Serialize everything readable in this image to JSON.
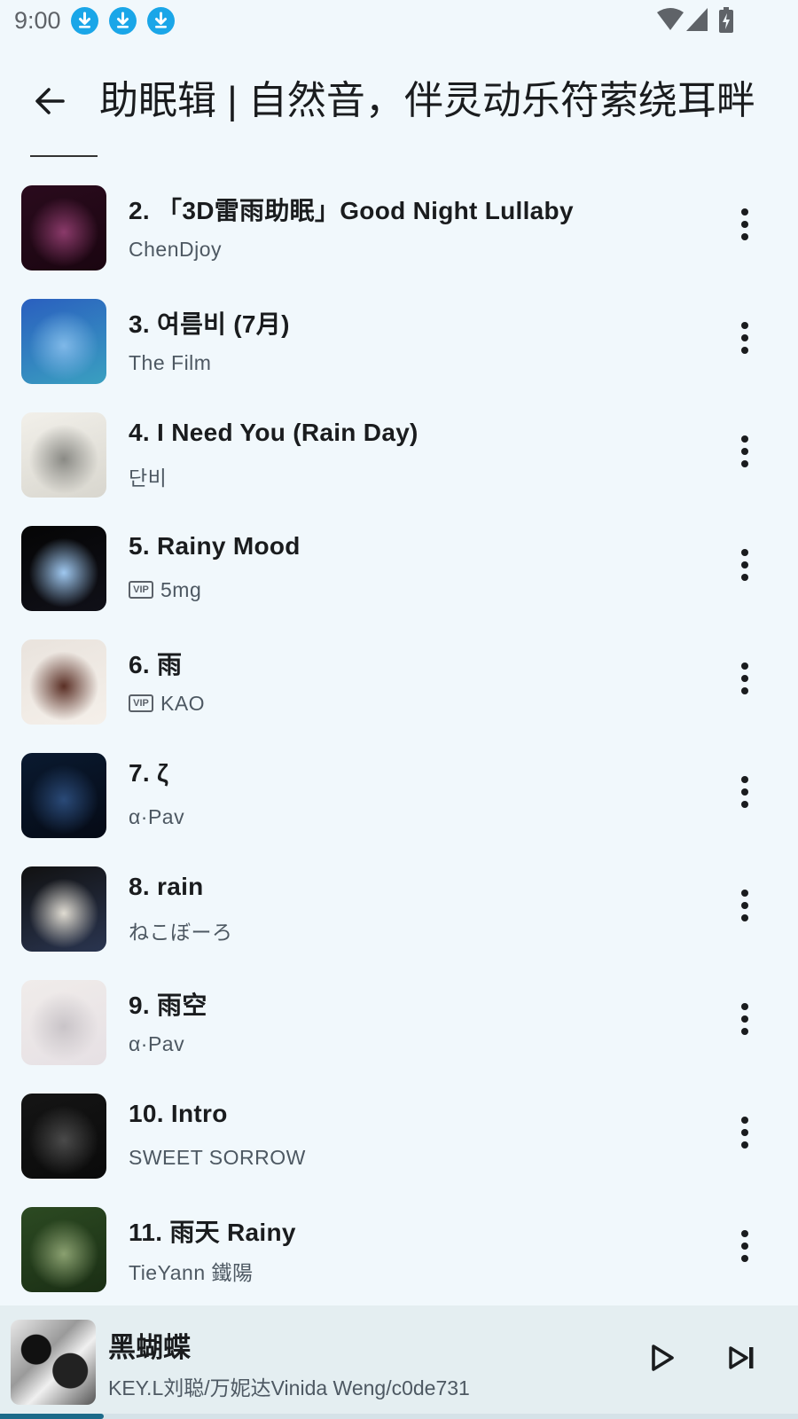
{
  "status_bar": {
    "time": "9:00",
    "notifications": [
      "download-icon",
      "download-icon",
      "download-icon"
    ],
    "right_icons": [
      "wifi-icon",
      "signal-icon",
      "battery-charging-icon"
    ]
  },
  "header": {
    "back_icon": "arrow-left-icon",
    "title": "助眠辑 | 自然音，伴灵动乐符萦绕耳畔"
  },
  "tracks": [
    {
      "title": "2. 「3D雷雨助眠」Good Night Lullaby",
      "artist": "ChenDjoy",
      "vip": false,
      "cover_colors": [
        "#2a0b1d",
        "#8a3a6a",
        "#1a0510"
      ]
    },
    {
      "title": "3. 여름비 (7月)",
      "artist": "The Film",
      "vip": false,
      "cover_colors": [
        "#2a5fbf",
        "#7fb8e8",
        "#3aa0c0"
      ]
    },
    {
      "title": "4. I Need You (Rain Day)",
      "artist": "단비",
      "vip": false,
      "cover_colors": [
        "#f2f0ea",
        "#8a8a85",
        "#d8d6ce"
      ]
    },
    {
      "title": "5. Rainy Mood",
      "artist": "5mg",
      "vip": true,
      "vip_label": "VIP",
      "cover_colors": [
        "#050505",
        "#9fc8f0",
        "#101018"
      ]
    },
    {
      "title": "6. 雨",
      "artist": "KAO",
      "vip": true,
      "vip_label": "VIP",
      "cover_colors": [
        "#e9e3dd",
        "#5a2f25",
        "#f5f0ea"
      ]
    },
    {
      "title": "7. ζ",
      "artist": "α·Pav",
      "vip": false,
      "cover_colors": [
        "#0a1a30",
        "#2a4a78",
        "#050a15"
      ]
    },
    {
      "title": "8. rain",
      "artist": "ねこぼーろ",
      "vip": false,
      "cover_colors": [
        "#111111",
        "#e0dcd2",
        "#2a3550"
      ]
    },
    {
      "title": "9. 雨空",
      "artist": "α·Pav",
      "vip": false,
      "cover_colors": [
        "#f0ecea",
        "#c9c4c8",
        "#e6e0e4"
      ]
    },
    {
      "title": "10. Intro",
      "artist": "SWEET SORROW",
      "vip": false,
      "cover_colors": [
        "#151515",
        "#4a4a4a",
        "#0a0a0a"
      ]
    },
    {
      "title": "11. 雨天 Rainy",
      "artist": "TieYann 鐵陽",
      "vip": false,
      "cover_colors": [
        "#2c4a22",
        "#8aa070",
        "#1a2e14"
      ]
    }
  ],
  "mini_player": {
    "title": "黑蝴蝶",
    "artist": "KEY.L刘聪/万妮达Vinida Weng/c0de731",
    "play_icon": "play-icon",
    "next_icon": "skip-next-icon",
    "progress_percent": 13
  },
  "colors": {
    "background": "#f1f8fc",
    "mini_player_bg": "#e4eef1",
    "accent": "#1c6a8a",
    "download_badge": "#1aa6e8"
  }
}
